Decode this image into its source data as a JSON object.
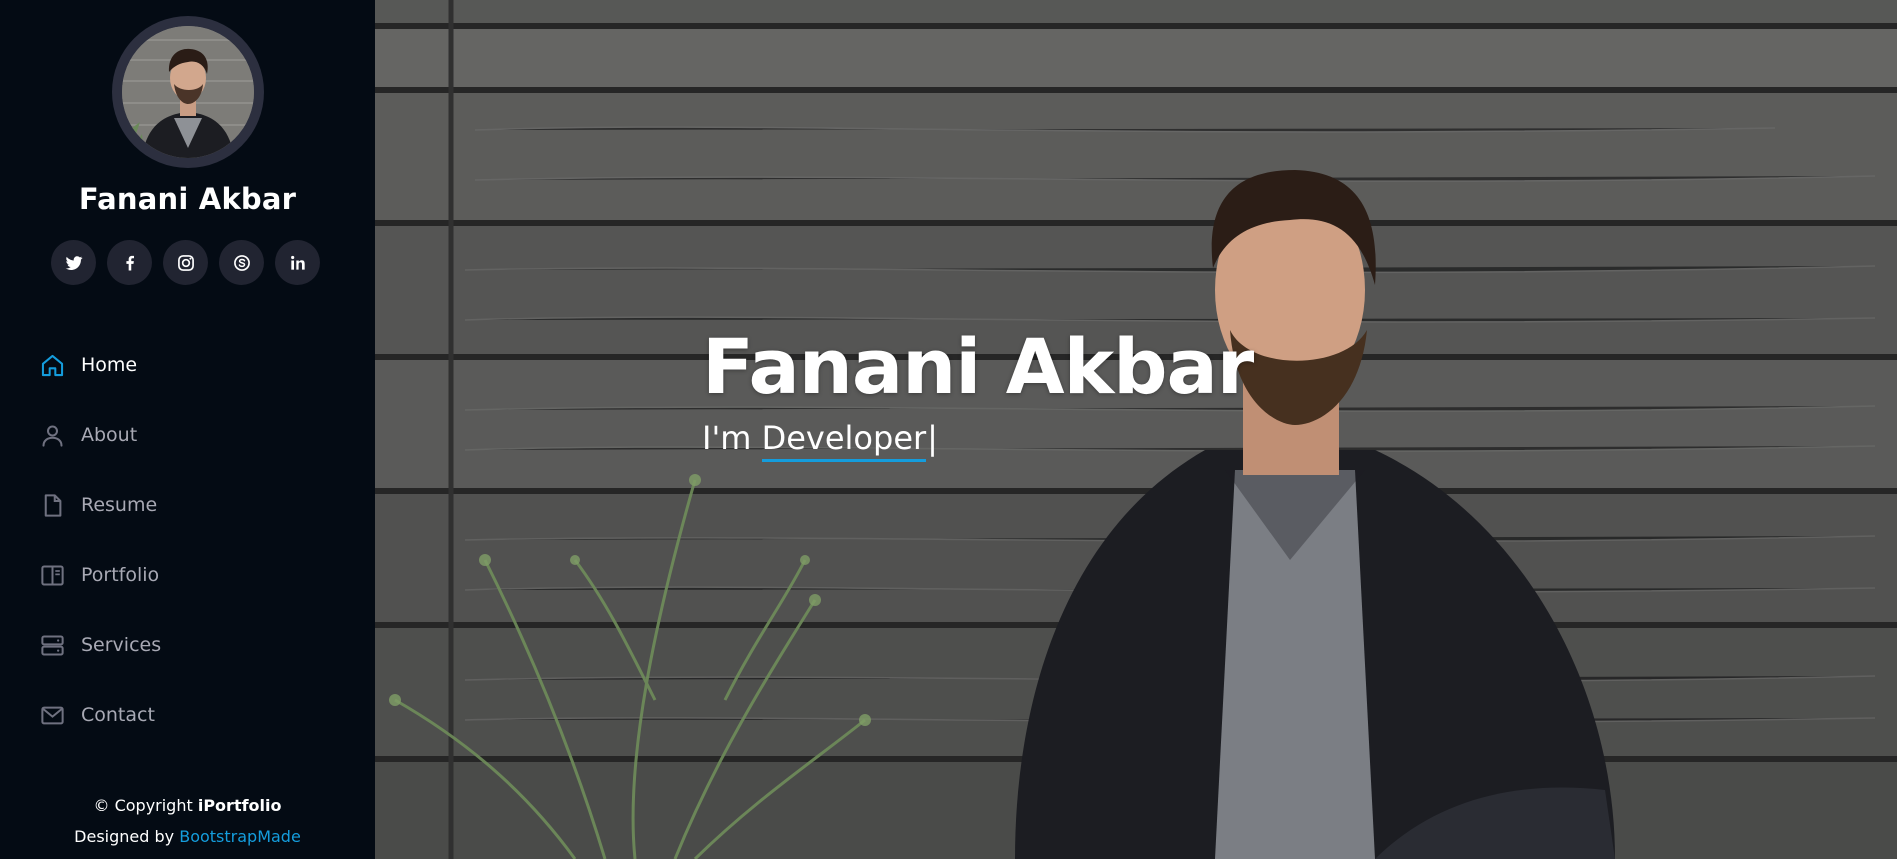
{
  "profile": {
    "name": "Fanani Akbar"
  },
  "social": [
    {
      "icon": "twitter-icon"
    },
    {
      "icon": "facebook-icon"
    },
    {
      "icon": "instagram-icon"
    },
    {
      "icon": "skype-icon"
    },
    {
      "icon": "linkedin-icon"
    }
  ],
  "nav": {
    "items": [
      {
        "label": "Home",
        "icon": "home-icon",
        "active": true
      },
      {
        "label": "About",
        "icon": "person-icon",
        "active": false
      },
      {
        "label": "Resume",
        "icon": "file-icon",
        "active": false
      },
      {
        "label": "Portfolio",
        "icon": "book-icon",
        "active": false
      },
      {
        "label": "Services",
        "icon": "server-icon",
        "active": false
      },
      {
        "label": "Contact",
        "icon": "envelope-icon",
        "active": false
      }
    ]
  },
  "footer": {
    "copyright_prefix": "© Copyright ",
    "brand": "iPortfolio",
    "designed_prefix": "Designed by ",
    "designed_link": "BootstrapMade"
  },
  "hero": {
    "title": "Fanani Akbar",
    "subtitle_prefix": "I'm ",
    "typed_word": "Developer",
    "cursor": "|"
  },
  "colors": {
    "accent": "#149ddd",
    "sidebar_bg": "#040b14",
    "social_bg": "#212431",
    "nav_text": "#a8a9b4"
  }
}
